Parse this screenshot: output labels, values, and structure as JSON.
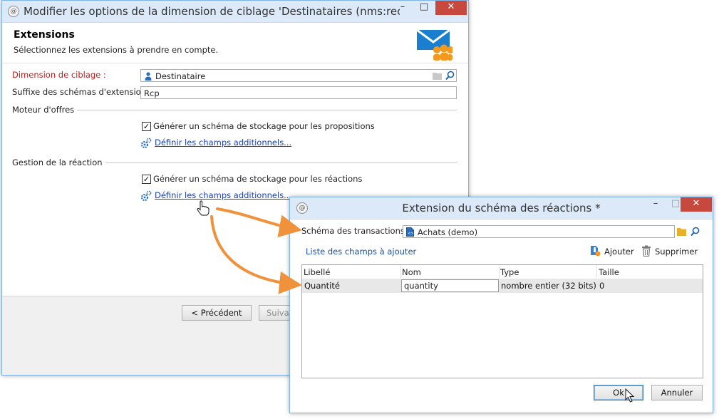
{
  "main_window": {
    "title": "Modifier les options de la dimension de ciblage 'Destinataires (nms:recipient...",
    "section_title": "Extensions",
    "section_subtitle": "Sélectionnez les extensions à prendre en compte.",
    "targeting_label": "Dimension de ciblage :",
    "targeting_value": "Destinataire",
    "suffix_label": "Suffixe des schémas d'extension :",
    "suffix_value": "Rcp",
    "offers_group": "Moteur d'offres",
    "offers_checkbox_label": "Générer un schéma de stockage pour les propositions",
    "offers_link": "Définir les champs additionnels...",
    "reaction_group": "Gestion de la réaction",
    "reaction_checkbox_label": "Générer un schéma de stockage pour les réactions",
    "reaction_link": "Définir les champs additionnels...",
    "prev_button": "< Précédent",
    "next_button": "Suivan"
  },
  "dialog": {
    "title": "Extension du schéma des réactions *",
    "transactions_label": "Schéma des transactions :",
    "transactions_value": "Achats (demo)",
    "list_title": "Liste des champs à ajouter",
    "add_button": "Ajouter",
    "delete_button": "Supprimer",
    "columns": [
      "Libellé",
      "Nom",
      "Type",
      "Taille"
    ],
    "rows": [
      {
        "libelle": "Quantité",
        "nom": "quantity",
        "type": "nombre entier (32 bits)",
        "taille": "0"
      }
    ],
    "ok_button": "Ok",
    "cancel_button": "Annuler"
  },
  "colors": {
    "accent_link": "#1a3fb8",
    "required_label": "#c41a1a",
    "arrow": "#f0923c",
    "close_button": "#c7483c",
    "titlebar": "#dbe9f8"
  }
}
